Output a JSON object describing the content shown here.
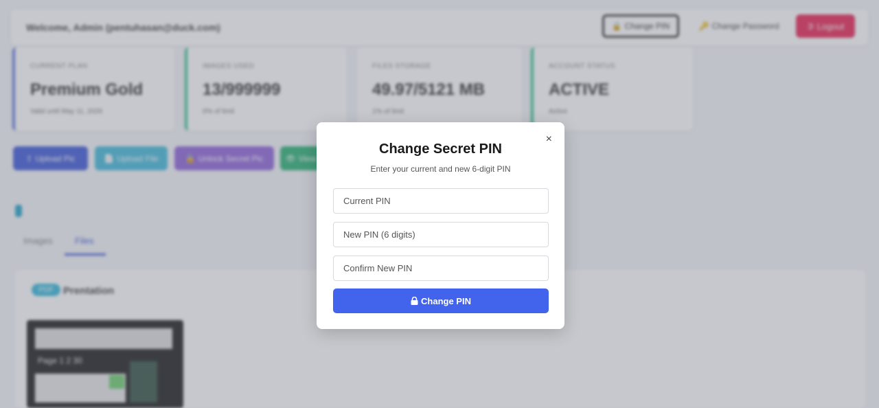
{
  "background": {
    "header": {
      "welcome": "Welcome, Admin (pentuhasan@duck.com)",
      "change_pin": "Change PIN",
      "change_password": "Change Password",
      "logout": "Logout"
    },
    "cards": [
      {
        "label": "CURRENT PLAN",
        "value": "Premium Gold",
        "sub": "Valid until May 11, 2026"
      },
      {
        "label": "IMAGES USED",
        "value": "13/999999",
        "sub": "0% of limit"
      },
      {
        "label": "FILES STORAGE",
        "value": "49.97/5121 MB",
        "sub": "1% of limit"
      },
      {
        "label": "ACCOUNT STATUS",
        "value": "ACTIVE",
        "sub": "Active"
      }
    ],
    "actions": {
      "upload_pic": "Upload Pic",
      "upload_file": "Upload File",
      "unlock_secret": "Unlock Secret Pic",
      "fourth": "View"
    },
    "tabs": {
      "images": "Images",
      "files": "Files"
    },
    "file": {
      "badge": "PDF",
      "name": "Prentation",
      "thumb_text": "Page  1  2  30"
    }
  },
  "modal": {
    "title": "Change Secret PIN",
    "subtitle": "Enter your current and new 6-digit PIN",
    "current_pin_placeholder": "Current PIN",
    "new_pin_placeholder": "New PIN (6 digits)",
    "confirm_pin_placeholder": "Confirm New PIN",
    "submit_label": "Change PIN",
    "close_symbol": "×"
  },
  "colors": {
    "primary": "#4263eb",
    "logout": "#e8194b",
    "overlay": "rgba(120,124,136,0.42)"
  }
}
